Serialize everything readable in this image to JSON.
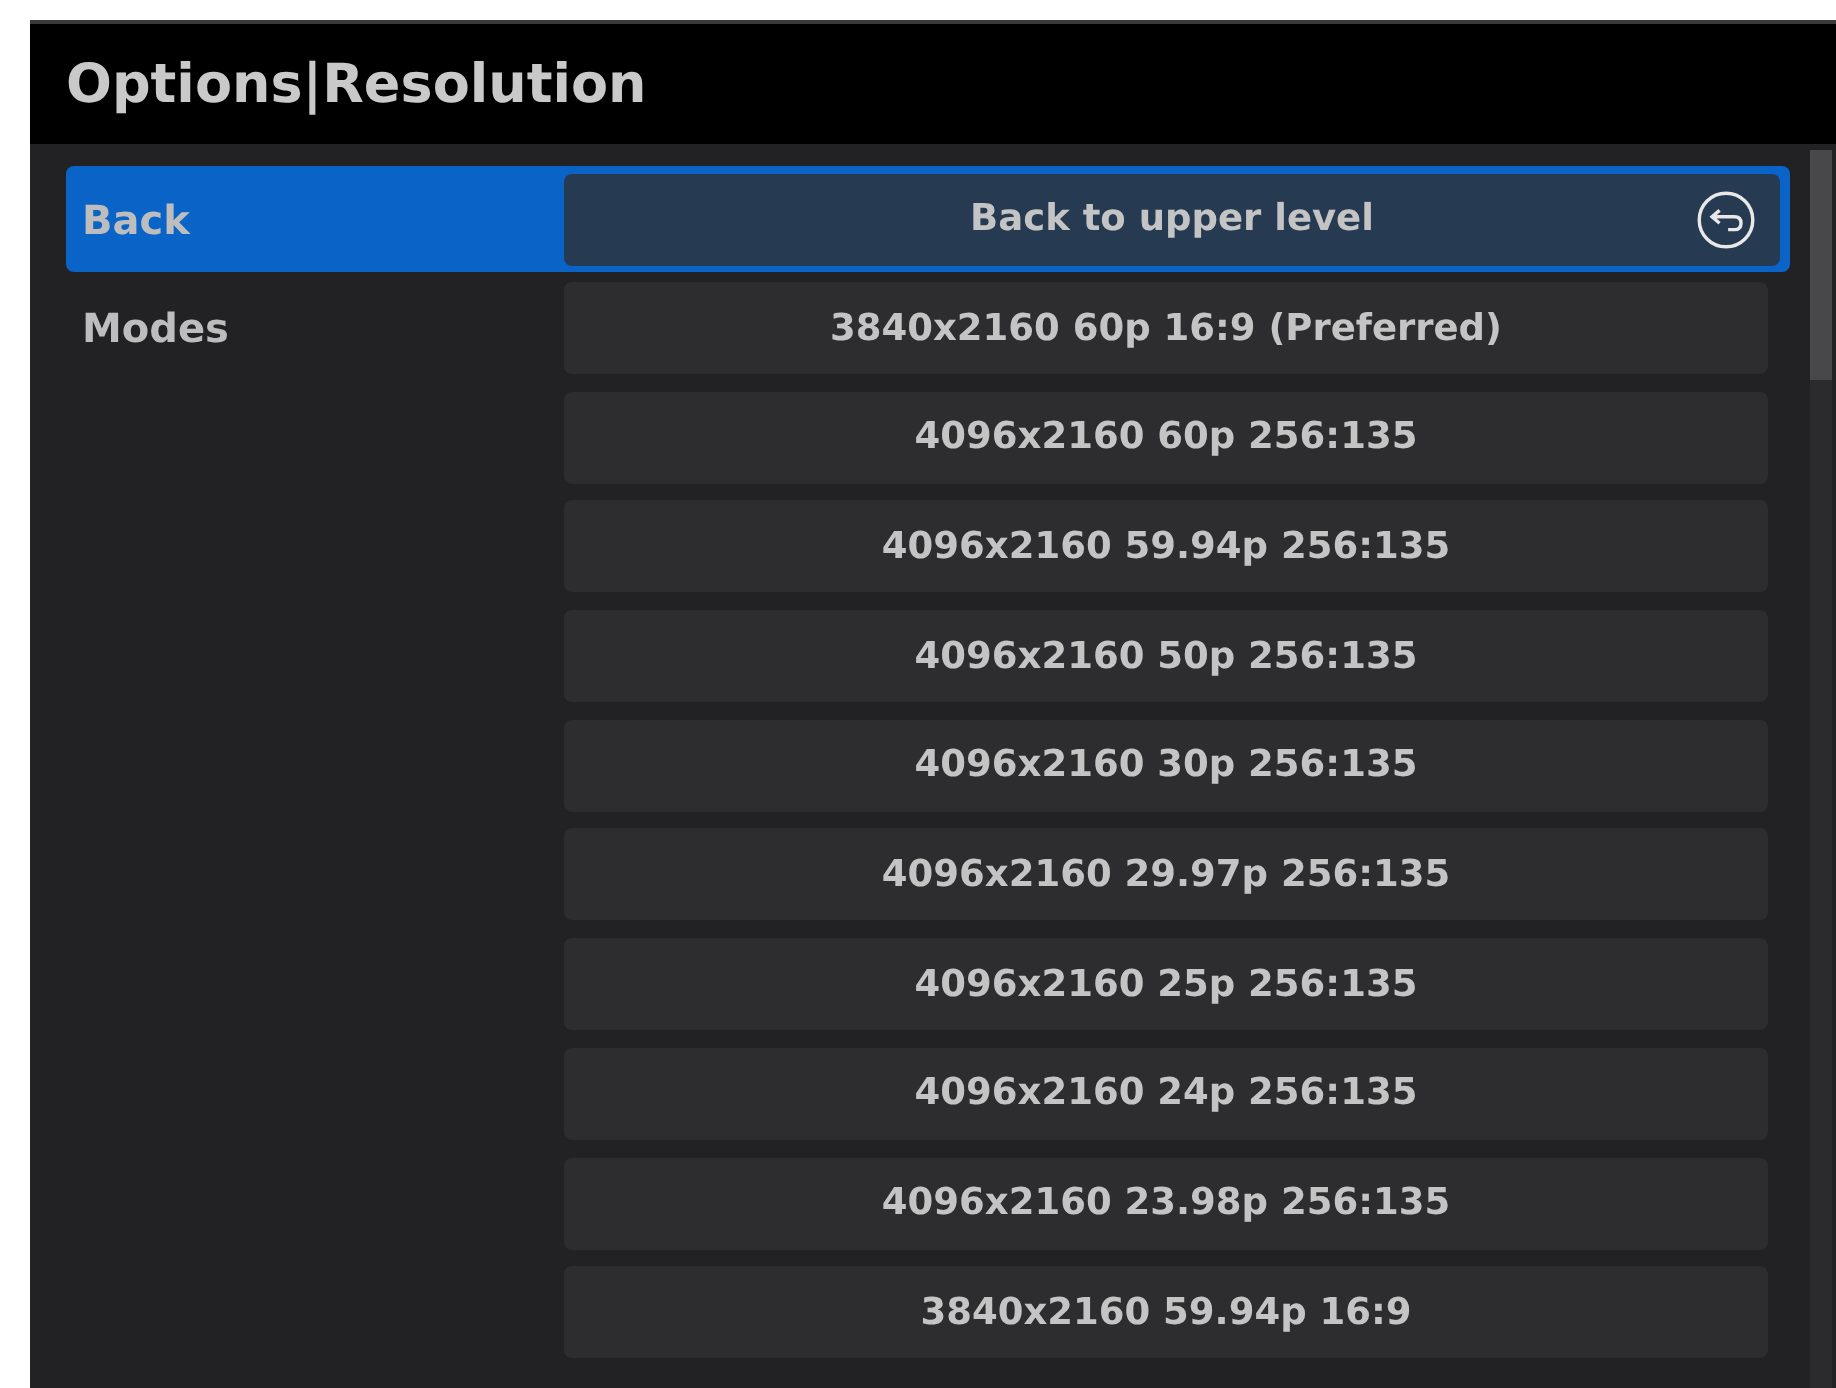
{
  "window": {
    "title": "Options|Resolution"
  },
  "rows": [
    {
      "kind": "back",
      "label": "Back",
      "value": "Back to upper level",
      "selected": true
    },
    {
      "kind": "mode",
      "label": "Modes",
      "value": "3840x2160 60p 16:9 (Preferred)",
      "selected": false
    },
    {
      "kind": "mode",
      "value": "4096x2160 60p 256:135",
      "selected": false
    },
    {
      "kind": "mode",
      "value": "4096x2160 59.94p 256:135",
      "selected": false
    },
    {
      "kind": "mode",
      "value": "4096x2160 50p 256:135",
      "selected": false
    },
    {
      "kind": "mode",
      "value": "4096x2160 30p 256:135",
      "selected": false
    },
    {
      "kind": "mode",
      "value": "4096x2160 29.97p 256:135",
      "selected": false
    },
    {
      "kind": "mode",
      "value": "4096x2160 25p 256:135",
      "selected": false
    },
    {
      "kind": "mode",
      "value": "4096x2160 24p 256:135",
      "selected": false
    },
    {
      "kind": "mode",
      "value": "4096x2160 23.98p 256:135",
      "selected": false
    },
    {
      "kind": "mode",
      "value": "3840x2160 59.94p 16:9",
      "selected": false
    }
  ]
}
